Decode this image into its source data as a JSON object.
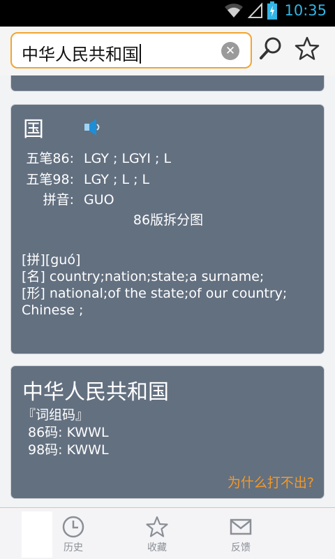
{
  "status_bar": {
    "time": "10:35",
    "icons": [
      "wifi-icon",
      "signal-icon",
      "battery-icon"
    ]
  },
  "search": {
    "value": "中华人民共和国"
  },
  "char_card": {
    "character": "国",
    "wubi86_label": "五笔86:",
    "wubi86_value": "LGY ; LGYI ; L",
    "wubi98_label": "五笔98:",
    "wubi98_value": "LGY ; L ; L",
    "pinyin_label": "拼音:",
    "pinyin_value": "GUO",
    "split_link": "86版拆分图",
    "definitions": [
      "[拼][guó]",
      "[名] country;nation;state;a surname;",
      "[形] national;of the state;of our country;",
      "Chinese ;"
    ]
  },
  "word_card": {
    "word": "中华人民共和国",
    "subtitle": "『词组码』",
    "code86": "86码:  KWWL",
    "code98": "98码:  KWWL",
    "why_link": "为什么打不出?"
  },
  "bottom_nav": {
    "history": "历史",
    "favorites": "收藏",
    "feedback": "反馈"
  },
  "colors": {
    "card": "#637080",
    "accent": "#f49a27",
    "status_blue": "#33b5e5"
  }
}
